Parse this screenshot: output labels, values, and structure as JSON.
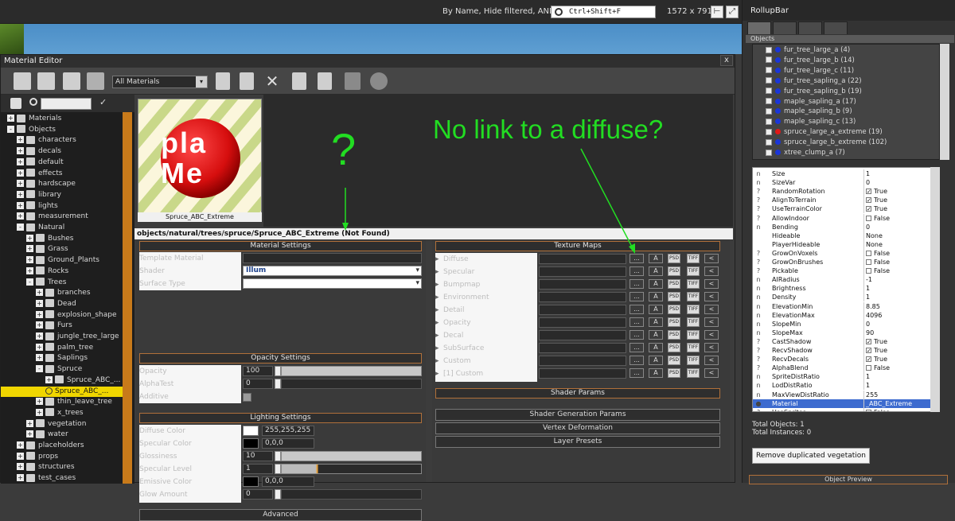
{
  "top": {
    "filter_text": "By Name, Hide filtered, AND",
    "search_placeholder": "Ctrl+Shift+F",
    "resolution": "1572 x 791"
  },
  "editor": {
    "title": "Material Editor",
    "close": "x",
    "material_filter": "All Materials",
    "preview_text": "pla Me",
    "preview_name": "Spruce_ABC_Extreme",
    "path": "objects/natural/trees/spruce/Spruce_ABC_Extreme (Not Found)",
    "tree": [
      {
        "label": "Materials",
        "level": 0,
        "sign": "+"
      },
      {
        "label": "Objects",
        "level": 0,
        "sign": "-"
      },
      {
        "label": "characters",
        "level": 1,
        "sign": "+"
      },
      {
        "label": "decals",
        "level": 1,
        "sign": "+"
      },
      {
        "label": "default",
        "level": 1,
        "sign": "+"
      },
      {
        "label": "effects",
        "level": 1,
        "sign": "+"
      },
      {
        "label": "hardscape",
        "level": 1,
        "sign": "+"
      },
      {
        "label": "library",
        "level": 1,
        "sign": "+"
      },
      {
        "label": "lights",
        "level": 1,
        "sign": "+"
      },
      {
        "label": "measurement",
        "level": 1,
        "sign": "+"
      },
      {
        "label": "Natural",
        "level": 1,
        "sign": "-"
      },
      {
        "label": "Bushes",
        "level": 2,
        "sign": "+"
      },
      {
        "label": "Grass",
        "level": 2,
        "sign": "+"
      },
      {
        "label": "Ground_Plants",
        "level": 2,
        "sign": "+"
      },
      {
        "label": "Rocks",
        "level": 2,
        "sign": "+"
      },
      {
        "label": "Trees",
        "level": 2,
        "sign": "-"
      },
      {
        "label": "branches",
        "level": 3,
        "sign": "+"
      },
      {
        "label": "Dead",
        "level": 3,
        "sign": "+"
      },
      {
        "label": "explosion_shape",
        "level": 3,
        "sign": "+"
      },
      {
        "label": "Furs",
        "level": 3,
        "sign": "+"
      },
      {
        "label": "jungle_tree_large",
        "level": 3,
        "sign": "+"
      },
      {
        "label": "palm_tree",
        "level": 3,
        "sign": "+"
      },
      {
        "label": "Saplings",
        "level": 3,
        "sign": "+"
      },
      {
        "label": "Spruce",
        "level": 3,
        "sign": "-"
      },
      {
        "label": "Spruce_ABC_...",
        "level": 4,
        "sign": "+"
      },
      {
        "label": "Spruce_ABC_...",
        "level": 4,
        "sign": "",
        "selected": true
      },
      {
        "label": "thin_leave_tree",
        "level": 3,
        "sign": "+"
      },
      {
        "label": "x_trees",
        "level": 3,
        "sign": "+"
      },
      {
        "label": "vegetation",
        "level": 2,
        "sign": "+"
      },
      {
        "label": "water",
        "level": 2,
        "sign": "+"
      },
      {
        "label": "placeholders",
        "level": 1,
        "sign": "+"
      },
      {
        "label": "props",
        "level": 1,
        "sign": "+"
      },
      {
        "label": "structures",
        "level": 1,
        "sign": "+"
      },
      {
        "label": "test_cases",
        "level": 1,
        "sign": "+"
      }
    ],
    "material_settings": {
      "title": "Material Settings",
      "template_label": "Template Material",
      "shader_label": "Shader",
      "shader_value": "Illum",
      "surface_label": "Surface Type"
    },
    "opacity_settings": {
      "title": "Opacity Settings",
      "opacity_label": "Opacity",
      "opacity_value": "100",
      "alphatest_label": "AlphaTest",
      "alphatest_value": "0",
      "additive_label": "Additive"
    },
    "lighting_settings": {
      "title": "Lighting Settings",
      "diffuse_label": "Diffuse Color",
      "diffuse_value": "255,255,255",
      "specular_label": "Specular Color",
      "specular_value": "0,0,0",
      "gloss_label": "Glossiness",
      "gloss_value": "10",
      "speclevel_label": "Specular Level",
      "speclevel_value": "1",
      "emissive_label": "Emissive Color",
      "emissive_value": "0,0,0",
      "glow_label": "Glow Amount",
      "glow_value": "0"
    },
    "advanced": "Advanced",
    "texture_maps": {
      "title": "Texture Maps",
      "rows": [
        "Diffuse",
        "Specular",
        "Bumpmap",
        "Environment",
        "Detail",
        "Opacity",
        "Decal",
        "SubSurface",
        "Custom",
        "[1] Custom"
      ],
      "btn_browse": "...",
      "btn_a": "A",
      "btn_psd": "PSD",
      "btn_tif": "TIFF",
      "btn_back": "<"
    },
    "shader_params": "Shader Params",
    "shader_gen_params": "Shader Generation Params",
    "vertex_deformation": "Vertex Deformation",
    "layer_presets": "Layer Presets"
  },
  "annotations": {
    "question": "?",
    "no_link": "No link to a diffuse?",
    "color": "#22dd22"
  },
  "rollup": {
    "title": "RollupBar",
    "objects_header": "Objects",
    "objects": [
      {
        "name": "fur_tree_large_a (4)",
        "dot": "#1a35d8"
      },
      {
        "name": "fur_tree_large_b (14)",
        "dot": "#1a35d8"
      },
      {
        "name": "fur_tree_large_c (11)",
        "dot": "#1a35d8"
      },
      {
        "name": "fur_tree_sapling_a (22)",
        "dot": "#1a35d8"
      },
      {
        "name": "fur_tree_sapling_b (19)",
        "dot": "#1a35d8"
      },
      {
        "name": "maple_sapling_a (17)",
        "dot": "#1a35d8"
      },
      {
        "name": "maple_sapling_b (9)",
        "dot": "#1a35d8"
      },
      {
        "name": "maple_sapling_c (13)",
        "dot": "#1a35d8"
      },
      {
        "name": "spruce_large_a_extreme (19)",
        "dot": "#e01818"
      },
      {
        "name": "spruce_large_b_extreme (102)",
        "dot": "#1a35d8"
      },
      {
        "name": "xtree_clump_a (7)",
        "dot": "#1a35d8"
      }
    ],
    "properties": [
      {
        "ind": "n",
        "name": "Size",
        "value": "1"
      },
      {
        "ind": "n",
        "name": "SizeVar",
        "value": "0"
      },
      {
        "ind": "?",
        "name": "RandomRotation",
        "value": "True",
        "check": true
      },
      {
        "ind": "?",
        "name": "AlignToTerrain",
        "value": "True",
        "check": true
      },
      {
        "ind": "?",
        "name": "UseTerrainColor",
        "value": "True",
        "check": true
      },
      {
        "ind": "?",
        "name": "AllowIndoor",
        "value": "False",
        "check": false
      },
      {
        "ind": "n",
        "name": "Bending",
        "value": "0"
      },
      {
        "ind": "",
        "name": "Hideable",
        "value": "None"
      },
      {
        "ind": "",
        "name": "PlayerHideable",
        "value": "None"
      },
      {
        "ind": "?",
        "name": "GrowOnVoxels",
        "value": "False",
        "check": false
      },
      {
        "ind": "?",
        "name": "GrowOnBrushes",
        "value": "False",
        "check": false
      },
      {
        "ind": "?",
        "name": "Pickable",
        "value": "False",
        "check": false
      },
      {
        "ind": "n",
        "name": "AIRadius",
        "value": "-1"
      },
      {
        "ind": "n",
        "name": "Brightness",
        "value": "1"
      },
      {
        "ind": "n",
        "name": "Density",
        "value": "1"
      },
      {
        "ind": "n",
        "name": "ElevationMin",
        "value": "8.85"
      },
      {
        "ind": "n",
        "name": "ElevationMax",
        "value": "4096"
      },
      {
        "ind": "n",
        "name": "SlopeMin",
        "value": "0"
      },
      {
        "ind": "n",
        "name": "SlopeMax",
        "value": "90"
      },
      {
        "ind": "?",
        "name": "CastShadow",
        "value": "True",
        "check": true
      },
      {
        "ind": "?",
        "name": "RecvShadow",
        "value": "True",
        "check": true
      },
      {
        "ind": "?",
        "name": "RecvDecals",
        "value": "True",
        "check": true
      },
      {
        "ind": "?",
        "name": "AlphaBlend",
        "value": "False",
        "check": false
      },
      {
        "ind": "n",
        "name": "SpriteDistRatio",
        "value": "1"
      },
      {
        "ind": "n",
        "name": "LodDistRatio",
        "value": "1"
      },
      {
        "ind": "n",
        "name": "MaxViewDistRatio",
        "value": "255"
      },
      {
        "ind": "●",
        "name": "Material",
        "value": "_ABC_Extreme",
        "selected": true
      },
      {
        "ind": "?",
        "name": "UseSprites",
        "value": "False",
        "check": false
      }
    ],
    "total_objects": "Total Objects: 1",
    "total_instances": "Total Instances: 0",
    "remove_button": "Remove duplicated vegetation",
    "object_preview": "Object Preview"
  }
}
